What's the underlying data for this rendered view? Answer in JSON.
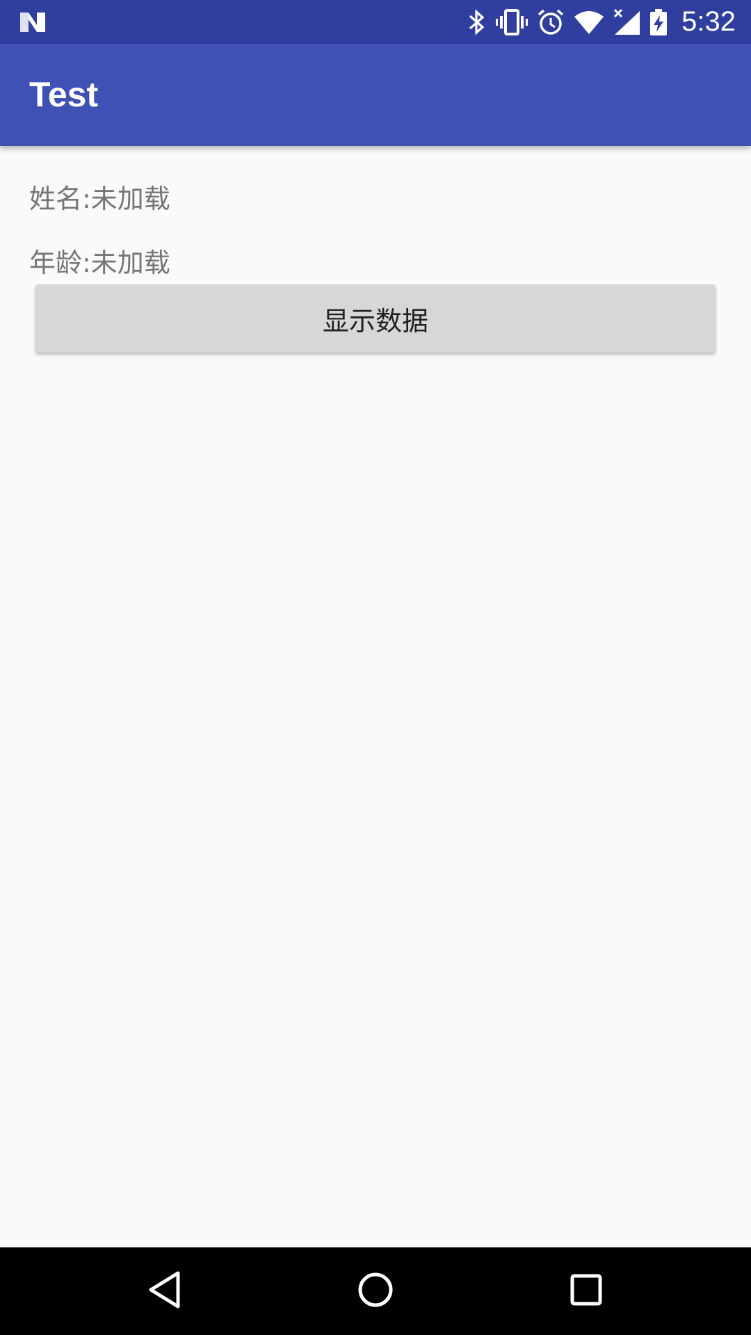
{
  "status_bar": {
    "time": "5:32",
    "icons": [
      "n-logo-icon",
      "bluetooth-icon",
      "vibrate-icon",
      "alarm-icon",
      "wifi-icon",
      "signal-icon",
      "battery-charging-icon"
    ],
    "background": "#303f9f"
  },
  "app_bar": {
    "title": "Test",
    "background": "#3f51b5"
  },
  "content": {
    "name_line": "姓名:未加载",
    "age_line": "年龄:未加载",
    "show_button_label": "显示数据"
  },
  "nav_bar": {
    "icons": [
      "back-icon",
      "home-icon",
      "recents-icon"
    ]
  }
}
